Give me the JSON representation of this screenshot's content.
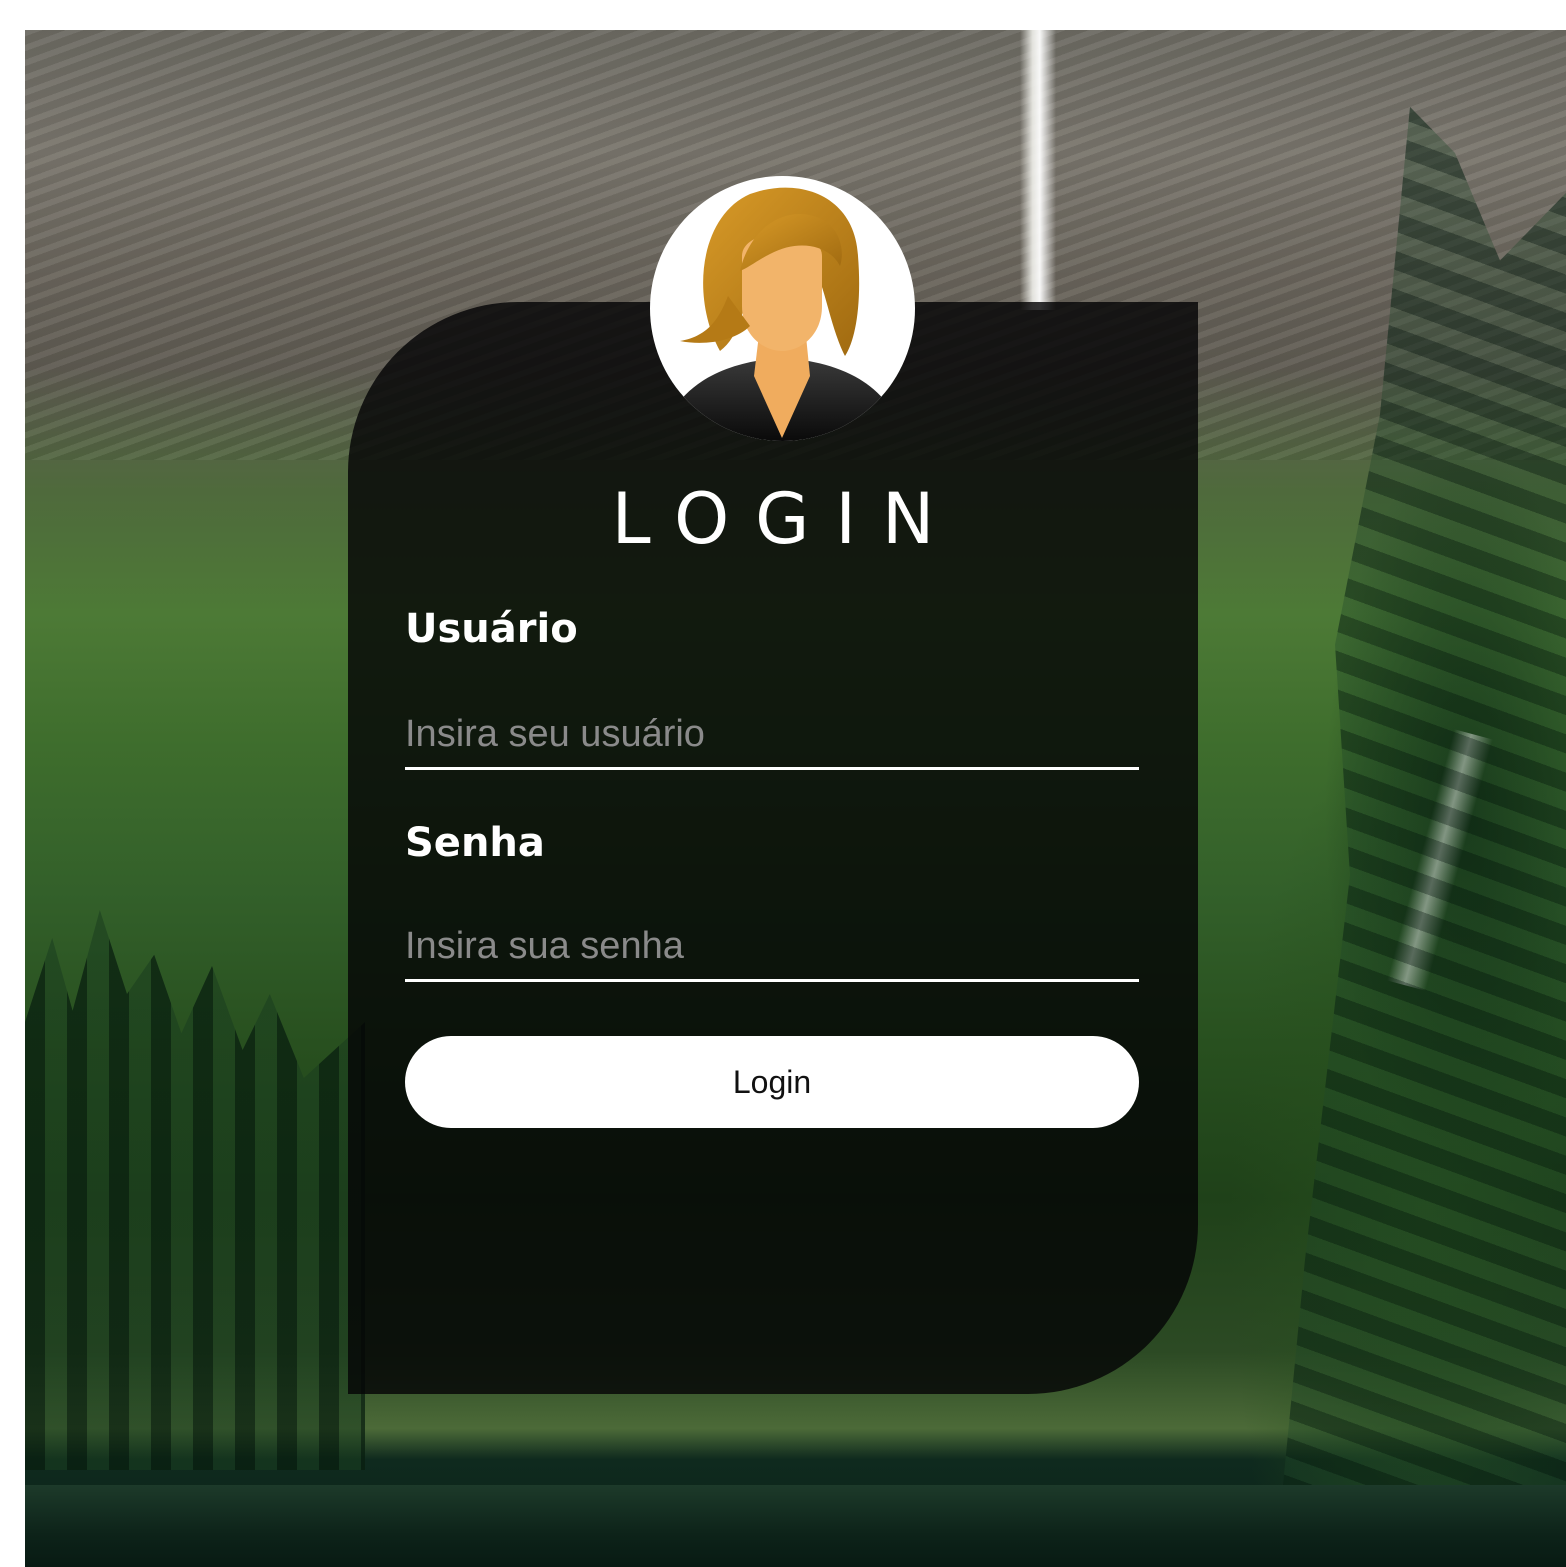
{
  "login_form": {
    "title": "LOGIN",
    "username_label": "Usuário",
    "username_placeholder": "Insira seu usuário",
    "password_label": "Senha",
    "password_placeholder": "Insira sua senha",
    "submit_label": "Login"
  },
  "avatar": {
    "icon": "woman-avatar-icon"
  },
  "colors": {
    "card_background": "#050506",
    "text": "#ffffff",
    "placeholder": "#8a8a8a",
    "button_background": "#ffffff",
    "button_text": "#111111",
    "avatar_hair": "#c48a1c",
    "avatar_skin": "#f2b46a"
  }
}
